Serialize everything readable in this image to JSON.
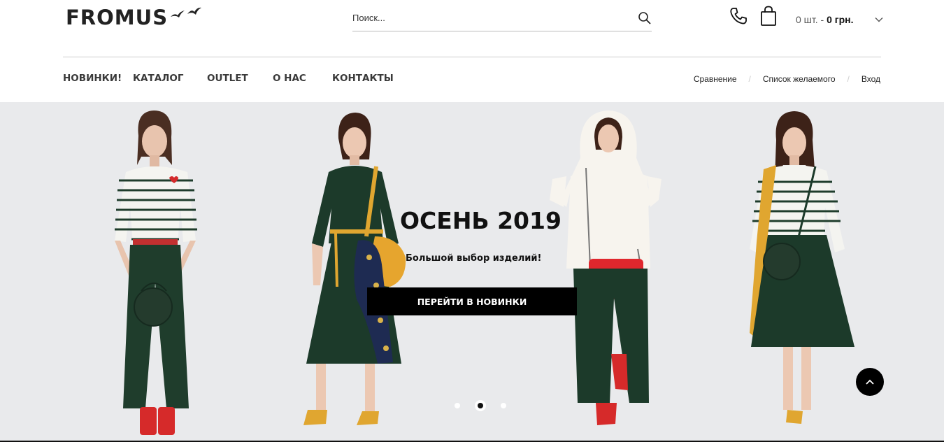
{
  "brand": {
    "name": "FROMUS"
  },
  "search": {
    "placeholder": "Поиск..."
  },
  "cart": {
    "count": "0 шт.",
    "separator": " - ",
    "total": "0 грн."
  },
  "main_nav": [
    {
      "label": "НОВИНКИ!"
    },
    {
      "label": "КАТАЛОГ"
    },
    {
      "label": "OUTLET"
    },
    {
      "label": "О НАС"
    },
    {
      "label": "КОНТАКТЫ"
    }
  ],
  "user_nav": [
    {
      "label": "Сравнение"
    },
    {
      "label": "Список желаемого"
    },
    {
      "label": "Вход"
    }
  ],
  "user_nav_separator": "/",
  "hero": {
    "title": "ОСЕНЬ 2019",
    "subtitle": "Большой выбор изделий!",
    "button_label": "ПЕРЕЙТИ В НОВИНКИ",
    "slides_total": 3,
    "active_slide": 2
  },
  "icons": {
    "search": "search-icon",
    "phone": "phone-icon",
    "bag": "shopping-bag-icon",
    "chevron": "chevron-down-icon",
    "to_top": "arrow-up-icon"
  },
  "colors": {
    "hero_bg": "#e9eaec",
    "button_bg": "#000000",
    "green_garment": "#1f3d2c",
    "mustard": "#e0a630",
    "red_accent": "#e0272d"
  }
}
